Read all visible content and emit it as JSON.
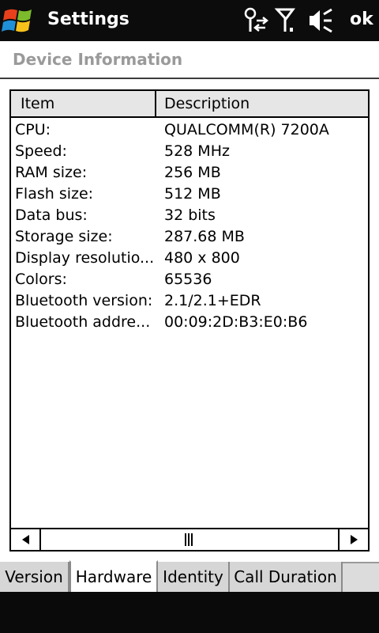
{
  "titlebar": {
    "title": "Settings",
    "ok_label": "ok",
    "icons": [
      "windows-start-icon",
      "connectivity-icon",
      "signal-icon",
      "volume-icon"
    ]
  },
  "header": {
    "title": "Device Information"
  },
  "list": {
    "columns": [
      "Item",
      "Description"
    ],
    "rows": [
      {
        "item": "CPU:",
        "description": "QUALCOMM(R) 7200A"
      },
      {
        "item": "Speed:",
        "description": "528 MHz"
      },
      {
        "item": "RAM size:",
        "description": "256 MB"
      },
      {
        "item": "Flash size:",
        "description": "512 MB"
      },
      {
        "item": "Data bus:",
        "description": "32 bits"
      },
      {
        "item": "Storage size:",
        "description": "287.68 MB"
      },
      {
        "item": "Display resolutio...",
        "description": "480 x 800"
      },
      {
        "item": "Colors:",
        "description": "65536"
      },
      {
        "item": "Bluetooth version:",
        "description": "2.1/2.1+EDR"
      },
      {
        "item": "Bluetooth addre...",
        "description": "00:09:2D:B3:E0:B6"
      }
    ]
  },
  "tabs": [
    {
      "label": "Version",
      "active": false
    },
    {
      "label": "Hardware",
      "active": true
    },
    {
      "label": "Identity",
      "active": false
    },
    {
      "label": "Call Duration",
      "active": false
    }
  ],
  "colors": {
    "titlebar_bg": "#0c0c0c",
    "header_text": "#9a9a9a",
    "list_header_bg": "#e6e6e6",
    "tabbar_bg": "#dcdcdc"
  }
}
